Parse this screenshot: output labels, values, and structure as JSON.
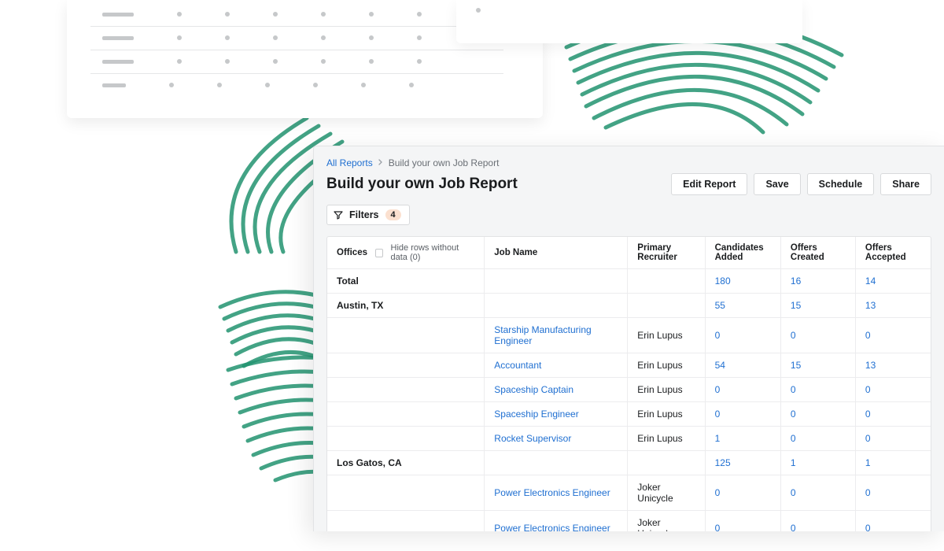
{
  "breadcrumb": {
    "root": "All Reports",
    "current": "Build your own Job Report"
  },
  "page_title": "Build your own Job Report",
  "actions": {
    "edit": "Edit Report",
    "save": "Save",
    "schedule": "Schedule",
    "share": "Share"
  },
  "filters": {
    "label": "Filters",
    "count": "4"
  },
  "table": {
    "headers": {
      "offices": "Offices",
      "hide_rows": "Hide rows without data (0)",
      "job_name": "Job Name",
      "primary_recruiter": "Primary Recruiter",
      "candidates_added": "Candidates Added",
      "offers_created": "Offers Created",
      "offers_accepted": "Offers Accepted"
    },
    "rows": [
      {
        "office": "Total",
        "job": "",
        "recruiter": "",
        "candidates": "180",
        "created": "16",
        "accepted": "14",
        "bold": true
      },
      {
        "office": "Austin, TX",
        "job": "",
        "recruiter": "",
        "candidates": "55",
        "created": "15",
        "accepted": "13",
        "bold": true
      },
      {
        "office": "",
        "job": "Starship Manufacturing Engineer",
        "recruiter": "Erin Lupus",
        "candidates": "0",
        "created": "0",
        "accepted": "0"
      },
      {
        "office": "",
        "job": "Accountant",
        "recruiter": "Erin Lupus",
        "candidates": "54",
        "created": "15",
        "accepted": "13"
      },
      {
        "office": "",
        "job": "Spaceship Captain",
        "recruiter": "Erin Lupus",
        "candidates": "0",
        "created": "0",
        "accepted": "0"
      },
      {
        "office": "",
        "job": "Spaceship Engineer",
        "recruiter": "Erin Lupus",
        "candidates": "0",
        "created": "0",
        "accepted": "0"
      },
      {
        "office": "",
        "job": "Rocket Supervisor",
        "recruiter": "Erin Lupus",
        "candidates": "1",
        "created": "0",
        "accepted": "0"
      },
      {
        "office": "Los Gatos, CA",
        "job": "",
        "recruiter": "",
        "candidates": "125",
        "created": "1",
        "accepted": "1",
        "bold": true
      },
      {
        "office": "",
        "job": "Power Electronics Engineer",
        "recruiter": "Joker Unicycle",
        "candidates": "0",
        "created": "0",
        "accepted": "0"
      },
      {
        "office": "",
        "job": "Power Electronics Engineer",
        "recruiter": "Joker Unicycle",
        "candidates": "0",
        "created": "0",
        "accepted": "0"
      }
    ]
  }
}
